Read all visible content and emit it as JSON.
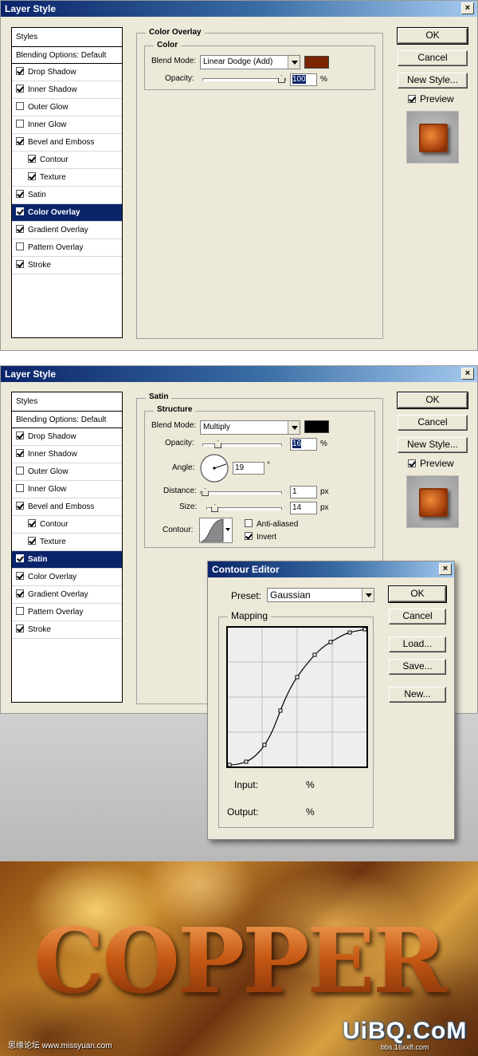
{
  "dialog1": {
    "title": "Layer Style",
    "styles": [
      {
        "label": "Styles"
      },
      {
        "label": "Blending Options: Default"
      },
      {
        "label": "Drop Shadow",
        "checked": true
      },
      {
        "label": "Inner Shadow",
        "checked": true
      },
      {
        "label": "Outer Glow",
        "checked": false
      },
      {
        "label": "Inner Glow",
        "checked": false
      },
      {
        "label": "Bevel and Emboss",
        "checked": true
      },
      {
        "label": "Contour",
        "checked": true,
        "indent": true
      },
      {
        "label": "Texture",
        "checked": true,
        "indent": true
      },
      {
        "label": "Satin",
        "checked": true
      },
      {
        "label": "Color Overlay",
        "checked": true,
        "selected": true
      },
      {
        "label": "Gradient Overlay",
        "checked": true
      },
      {
        "label": "Pattern Overlay",
        "checked": false
      },
      {
        "label": "Stroke",
        "checked": true
      }
    ],
    "section_title": "Color Overlay",
    "group_title": "Color",
    "blend_mode_label": "Blend Mode:",
    "blend_mode": "Linear Dodge (Add)",
    "color": "#7a2400",
    "opacity_label": "Opacity:",
    "opacity": "100",
    "opacity_fraction": 1.0,
    "unit": "%",
    "buttons": {
      "ok": "OK",
      "cancel": "Cancel",
      "new_style": "New Style..."
    },
    "preview_label": "Preview"
  },
  "dialog2": {
    "title": "Layer Style",
    "styles": [
      {
        "label": "Styles"
      },
      {
        "label": "Blending Options: Default"
      },
      {
        "label": "Drop Shadow",
        "checked": true
      },
      {
        "label": "Inner Shadow",
        "checked": true
      },
      {
        "label": "Outer Glow",
        "checked": false
      },
      {
        "label": "Inner Glow",
        "checked": false
      },
      {
        "label": "Bevel and Emboss",
        "checked": true
      },
      {
        "label": "Contour",
        "checked": true,
        "indent": true
      },
      {
        "label": "Texture",
        "checked": true,
        "indent": true
      },
      {
        "label": "Satin",
        "checked": true,
        "selected": true
      },
      {
        "label": "Color Overlay",
        "checked": true
      },
      {
        "label": "Gradient Overlay",
        "checked": true
      },
      {
        "label": "Pattern Overlay",
        "checked": false
      },
      {
        "label": "Stroke",
        "checked": true
      }
    ],
    "section_title": "Satin",
    "group_title": "Structure",
    "blend_mode_label": "Blend Mode:",
    "blend_mode": "Multiply",
    "color": "#000000",
    "opacity_label": "Opacity:",
    "opacity": "16",
    "opacity_fraction": 0.16,
    "angle_label": "Angle:",
    "angle": "19",
    "degree": "°",
    "distance_label": "Distance:",
    "distance": "1",
    "distance_fraction": 0.01,
    "size_label": "Size:",
    "size": "14",
    "size_fraction": 0.06,
    "px": "px",
    "unit": "%",
    "contour_label": "Contour:",
    "anti_aliased": "Anti-aliased",
    "invert": "Invert",
    "buttons": {
      "ok": "OK",
      "cancel": "Cancel",
      "new_style": "New Style..."
    },
    "preview_label": "Preview"
  },
  "contour_editor": {
    "title": "Contour Editor",
    "preset_label": "Preset:",
    "preset": "Gaussian",
    "mapping_label": "Mapping",
    "input_label": "Input:",
    "output_label": "Output:",
    "percent": "%",
    "buttons": {
      "ok": "OK",
      "cancel": "Cancel",
      "load": "Load...",
      "save": "Save...",
      "new": "New..."
    }
  },
  "banner": {
    "word": "COPPER",
    "left_caption": "思缘论坛 www.missyuan.com",
    "logo": "UiBQ.CoM",
    "logo_sub": "bbs.16xx8.com"
  }
}
